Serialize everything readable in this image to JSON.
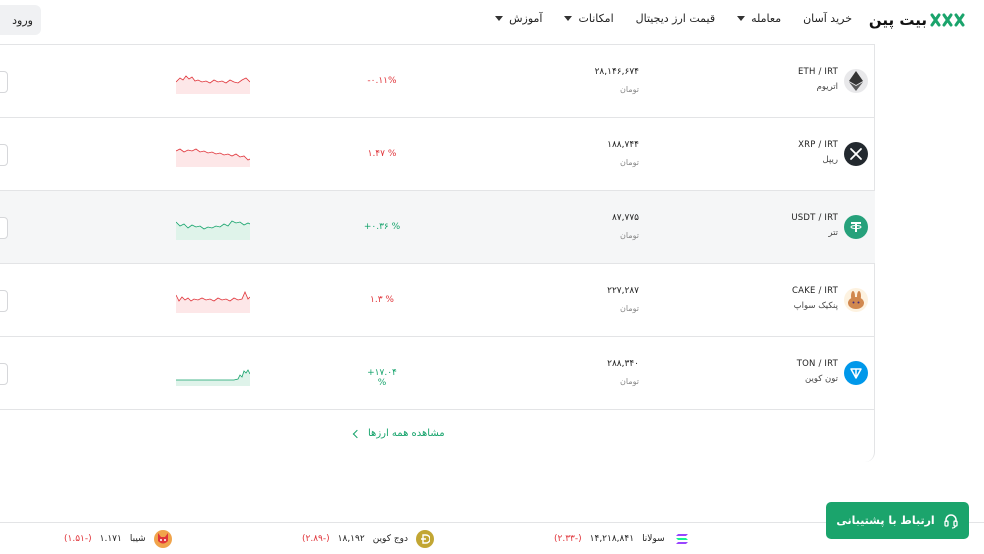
{
  "header": {
    "logo_text": "بیت پین",
    "login_label": "ورود",
    "nav": [
      {
        "label": "خرید آسان",
        "has_caret": false
      },
      {
        "label": "معامله",
        "has_caret": true
      },
      {
        "label": "قیمت ارز دیجیتال",
        "has_caret": false
      },
      {
        "label": "امکانات",
        "has_caret": true
      },
      {
        "label": "آموزش",
        "has_caret": true
      }
    ]
  },
  "market": {
    "rows": [
      {
        "pair": "ETH / IRT",
        "name": "اتریوم",
        "price": "۲۸,۱۴۶,۶۷۴",
        "unit": "تومان",
        "change": "-۰.۱۱%",
        "trend": "down",
        "icon": "ethereum-icon",
        "icon_color": "#e8e8ea",
        "spark_color": "#e0343a"
      },
      {
        "pair": "XRP / IRT",
        "name": "ریپل",
        "price": "۱۸۸,۷۴۴",
        "unit": "تومان",
        "change": "۱.۴۷ %",
        "trend": "down",
        "icon": "xrp-icon",
        "icon_color": "#23292f",
        "spark_color": "#e0343a"
      },
      {
        "pair": "USDT / IRT",
        "name": "تتر",
        "price": "۸۷,۷۷۵",
        "unit": "تومان",
        "change": "+۰.۳۶ %",
        "trend": "up",
        "icon": "tether-icon",
        "icon_color": "#26a17b",
        "spark_color": "#15a36b"
      },
      {
        "pair": "CAKE / IRT",
        "name": "پنکیک سواپ",
        "price": "۲۲۷,۲۸۷",
        "unit": "تومان",
        "change": "۱.۳ %",
        "trend": "down",
        "icon": "pancakeswap-icon",
        "icon_color": "#fdf2e0",
        "spark_color": "#e0343a"
      },
      {
        "pair": "TON / IRT",
        "name": "تون کوین",
        "price": "۲۸۸,۳۴۰",
        "unit": "تومان",
        "change": "+۱۷.۰۴ %",
        "trend": "up",
        "icon": "toncoin-icon",
        "icon_color": "#0098ea",
        "spark_color": "#15a36b"
      }
    ],
    "view_all_label": "مشاهده همه ارزها"
  },
  "support": {
    "label": "ارتباط با پشتیبانی",
    "icon": "headset-icon"
  },
  "ticker": [
    {
      "name": "سولانا",
      "price": "۱۴,۲۱۸,۸۴۱",
      "change": "(-۲.۳۳)",
      "icon": "solana-icon",
      "icon_color": "#9945ff"
    },
    {
      "name": "دوج کوین",
      "price": "۱۸,۱۹۲",
      "change": "(-۲.۸۹)",
      "icon": "dogecoin-icon",
      "icon_color": "#c2a633"
    },
    {
      "name": "شیبا",
      "price": "۱.۱۷۱",
      "change": "(-۱.۵۱)",
      "icon": "shiba-icon",
      "icon_color": "#f0a44b"
    }
  ]
}
